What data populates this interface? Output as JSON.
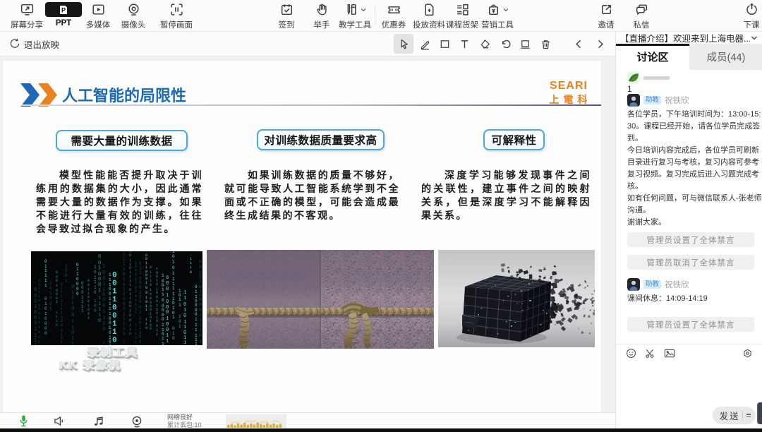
{
  "colors": {
    "accent_blue": "#1a6ab4",
    "accent_orange": "#e8821e",
    "box_border": "#45aadf",
    "mic_green": "#2fae3c"
  },
  "toolbar": {
    "items": [
      {
        "id": "screen-share",
        "label": "屏幕分享"
      },
      {
        "id": "ppt",
        "label": "PPT",
        "active": true
      },
      {
        "id": "multimedia",
        "label": "多媒体"
      },
      {
        "id": "camera",
        "label": "摄像头"
      },
      {
        "id": "pause-screen",
        "label": "暂停画面"
      },
      {
        "id": "sign-in",
        "label": "签到"
      },
      {
        "id": "raise-hand",
        "label": "举手"
      },
      {
        "id": "teaching-tools",
        "label": "教学工具",
        "dropdown": true
      },
      {
        "id": "coupon",
        "label": "优惠券"
      },
      {
        "id": "materials",
        "label": "投放资料"
      },
      {
        "id": "course-shelf",
        "label": "课程货架"
      },
      {
        "id": "marketing-tools",
        "label": "营销工具",
        "dropdown": true
      },
      {
        "id": "invite",
        "label": "邀请"
      },
      {
        "id": "private-message",
        "label": "私信"
      },
      {
        "id": "end-class",
        "label": "下课"
      }
    ]
  },
  "presenter_bar": {
    "exit_label": "退出放映"
  },
  "slide": {
    "title": "人工智能的局限性",
    "logo_text": "SEARI",
    "logo_subtext": "上電科",
    "columns": [
      {
        "heading": "需要大量的训练数据",
        "body": "模型性能能否提升取决于训练用的数据集的大小，因此通常需要大量的数据作为支撑。如果不能进行大量有效的训练，往往会导致过拟合现象的产生。"
      },
      {
        "heading": "对训练数据质量要求高",
        "body": "如果训练数据的质量不够好，就可能导致人工智能系统学到不全面或不正确的模型，可能会造成最终生成结果的不客观。"
      },
      {
        "heading": "可解释性",
        "body": "深度学习能够发现事件之间的关联性，建立事件之间的映射关系，但是深度学习不能解释因果关系。"
      }
    ],
    "watermark_line1": "录制工具",
    "watermark_line2": "KK 录像机"
  },
  "statusbar": {
    "network_status": "网络良好",
    "packet_loss": "累计丢包:10"
  },
  "sidebar": {
    "header_title": "【直播介绍】欢迎来到上海电器...",
    "tabs": [
      {
        "label": "讨论区",
        "active": true
      },
      {
        "label": "成员(44)",
        "active": false
      }
    ],
    "messages": [
      {
        "type": "chat",
        "avatar": "leaf",
        "badge": "",
        "name": "",
        "text": "1"
      },
      {
        "type": "chat",
        "avatar": "person",
        "badge": "助教",
        "name": "祝铁欣",
        "paragraphs": [
          "各位学员，下午培训时间为：13:00-15:30。课程已经开始，请各位学员完成签到。",
          "今日培训内容完成后，各位学员可刷新目录进行复习与考核，复习内容可参考复习视频。复习完成后进入习题完成考核。",
          "如有任何问题，可与微信联系人-张老师沟通。",
          "谢谢大家。"
        ]
      },
      {
        "type": "system",
        "text": "管理员设置了全体禁言"
      },
      {
        "type": "system",
        "text": "管理员取消了全体禁言"
      },
      {
        "type": "chat",
        "avatar": "person",
        "badge": "助教",
        "name": "祝铁欣",
        "text": "课间休息：14:09-14:19"
      },
      {
        "type": "system",
        "text": "管理员设置了全体禁言"
      }
    ],
    "send_label": "发送"
  }
}
